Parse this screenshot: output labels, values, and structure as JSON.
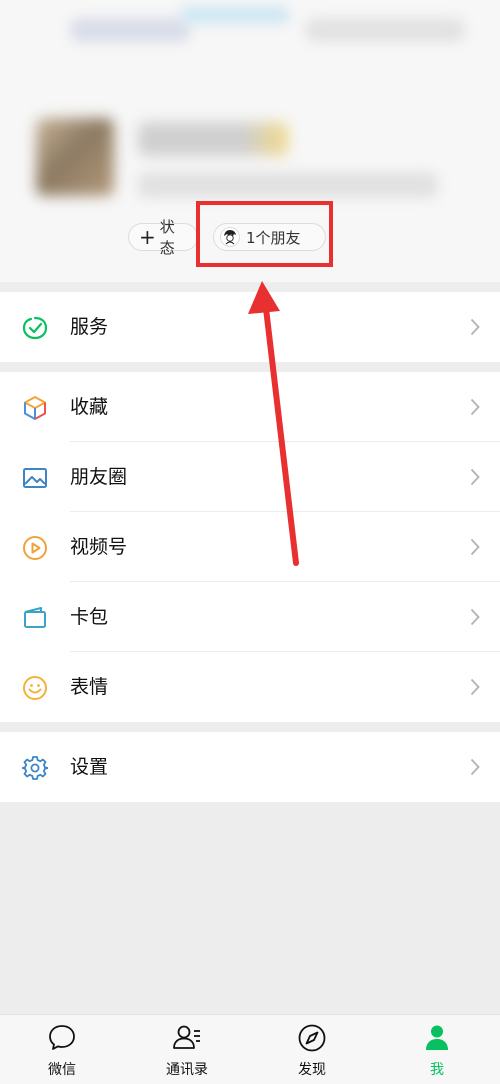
{
  "profile": {
    "status_button": {
      "icon": "plus-icon",
      "label": "状态"
    },
    "friends_button": {
      "icon": "friend-avatar-icon",
      "label": "1个朋友"
    }
  },
  "menu": {
    "group1": [
      {
        "label": "服务",
        "icon": "service-check-icon"
      }
    ],
    "group2": [
      {
        "label": "收藏",
        "icon": "cube-icon"
      },
      {
        "label": "朋友圈",
        "icon": "image-icon"
      },
      {
        "label": "视频号",
        "icon": "play-circle-icon"
      },
      {
        "label": "卡包",
        "icon": "card-icon"
      },
      {
        "label": "表情",
        "icon": "smile-icon"
      }
    ],
    "group3": [
      {
        "label": "设置",
        "icon": "gear-icon"
      }
    ]
  },
  "tabbar": {
    "tabs": [
      {
        "label": "微信",
        "icon": "chat-bubble-icon",
        "active": false
      },
      {
        "label": "通讯录",
        "icon": "contacts-icon",
        "active": false
      },
      {
        "label": "发现",
        "icon": "compass-icon",
        "active": false
      },
      {
        "label": "我",
        "icon": "person-icon",
        "active": true
      }
    ]
  },
  "colors": {
    "accent_green": "#07c160",
    "annotation_red": "#e83030"
  }
}
